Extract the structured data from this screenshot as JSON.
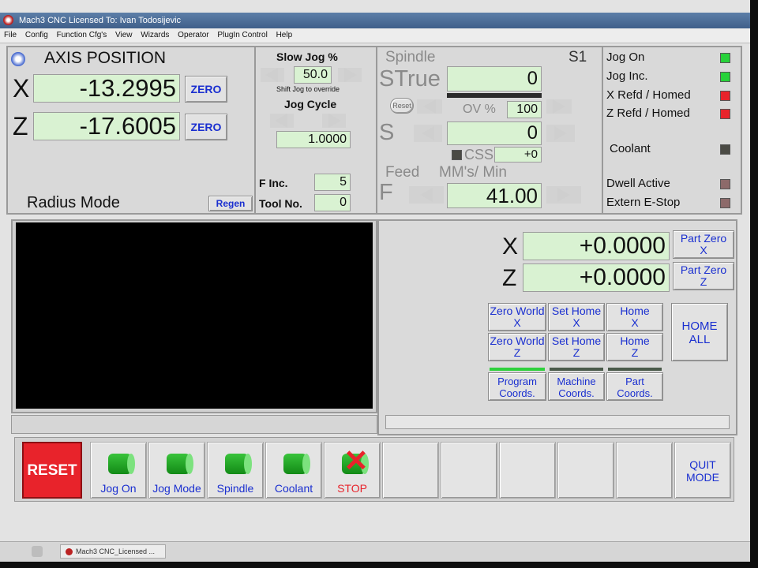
{
  "window": {
    "title": "Mach3 CNC  Licensed To: Ivan Todosijevic"
  },
  "menu": [
    "File",
    "Config",
    "Function Cfg's",
    "View",
    "Wizards",
    "Operator",
    "PlugIn Control",
    "Help"
  ],
  "axis": {
    "title": "AXIS POSITION",
    "x_label": "X",
    "x_value": "-13.2995",
    "z_label": "Z",
    "z_value": "-17.6005",
    "zero_label": "ZERO",
    "radius_mode": "Radius Mode",
    "regen": "Regen"
  },
  "jog": {
    "slow_jog_label": "Slow Jog %",
    "slow_jog_value": "50.0",
    "shift_hint": "Shift Jog to override",
    "jog_cycle_label": "Jog Cycle",
    "jog_cycle_value": "1.0000",
    "f_inc_label": "F Inc.",
    "f_inc_value": "5",
    "tool_no_label": "Tool No.",
    "tool_no_value": "0"
  },
  "spindle": {
    "title": "Spindle",
    "s1": "S1",
    "strue_label": "STrue",
    "strue_value": "0",
    "reset_label": "Reset",
    "ov_label": "OV %",
    "ov_value": "100",
    "s_label": "S",
    "s_value": "0",
    "css_label": "CSS",
    "css_value": "+0",
    "feed_label": "Feed",
    "feed_units": "MM's/ Min",
    "f_label": "F",
    "f_value": "41.00"
  },
  "status": {
    "items": [
      {
        "label": "Jog On",
        "color": "#27d23a"
      },
      {
        "label": "Jog Inc.",
        "color": "#27d23a"
      },
      {
        "label": "X Refd / Homed",
        "color": "#e8232b"
      },
      {
        "label": "Z Refd / Homed",
        "color": "#e8232b"
      }
    ],
    "coolant": {
      "label": "Coolant",
      "color": "#4a4a44"
    },
    "dwell": {
      "label": "Dwell Active",
      "color": "#8d6a6a"
    },
    "estop": {
      "label": "Extern E-Stop",
      "color": "#8d6a6a"
    }
  },
  "coords": {
    "x_label": "X",
    "x_value": "+0.0000",
    "z_label": "Z",
    "z_value": "+0.0000",
    "part_zero_x": [
      "Part Zero",
      "X"
    ],
    "part_zero_z": [
      "Part Zero",
      "Z"
    ],
    "grid": [
      [
        "Zero World",
        "X"
      ],
      [
        "Set Home",
        "X"
      ],
      [
        "Home",
        "X"
      ],
      [
        "Zero World",
        "Z"
      ],
      [
        "Set Home",
        "Z"
      ],
      [
        "Home",
        "Z"
      ]
    ],
    "home_all": [
      "HOME",
      "ALL"
    ],
    "program_coords": [
      "Program",
      "Coords."
    ],
    "machine_coords": [
      "Machine",
      "Coords."
    ],
    "part_coords": [
      "Part",
      "Coords."
    ],
    "active_color": "#2ed03c"
  },
  "toolbar": {
    "reset": "RESET",
    "jog_on": "Jog On",
    "jog_mode": "Jog Mode",
    "spindle": "Spindle",
    "coolant": "Coolant",
    "stop": "STOP",
    "quit_mode": [
      "QUIT",
      "MODE"
    ]
  },
  "taskbar": {
    "item": "Mach3 CNC_Licensed ..."
  },
  "colors": {
    "dro_bg": "#d9f2d2",
    "button_text": "#1a2fd0",
    "reset_red": "#e8232b"
  }
}
